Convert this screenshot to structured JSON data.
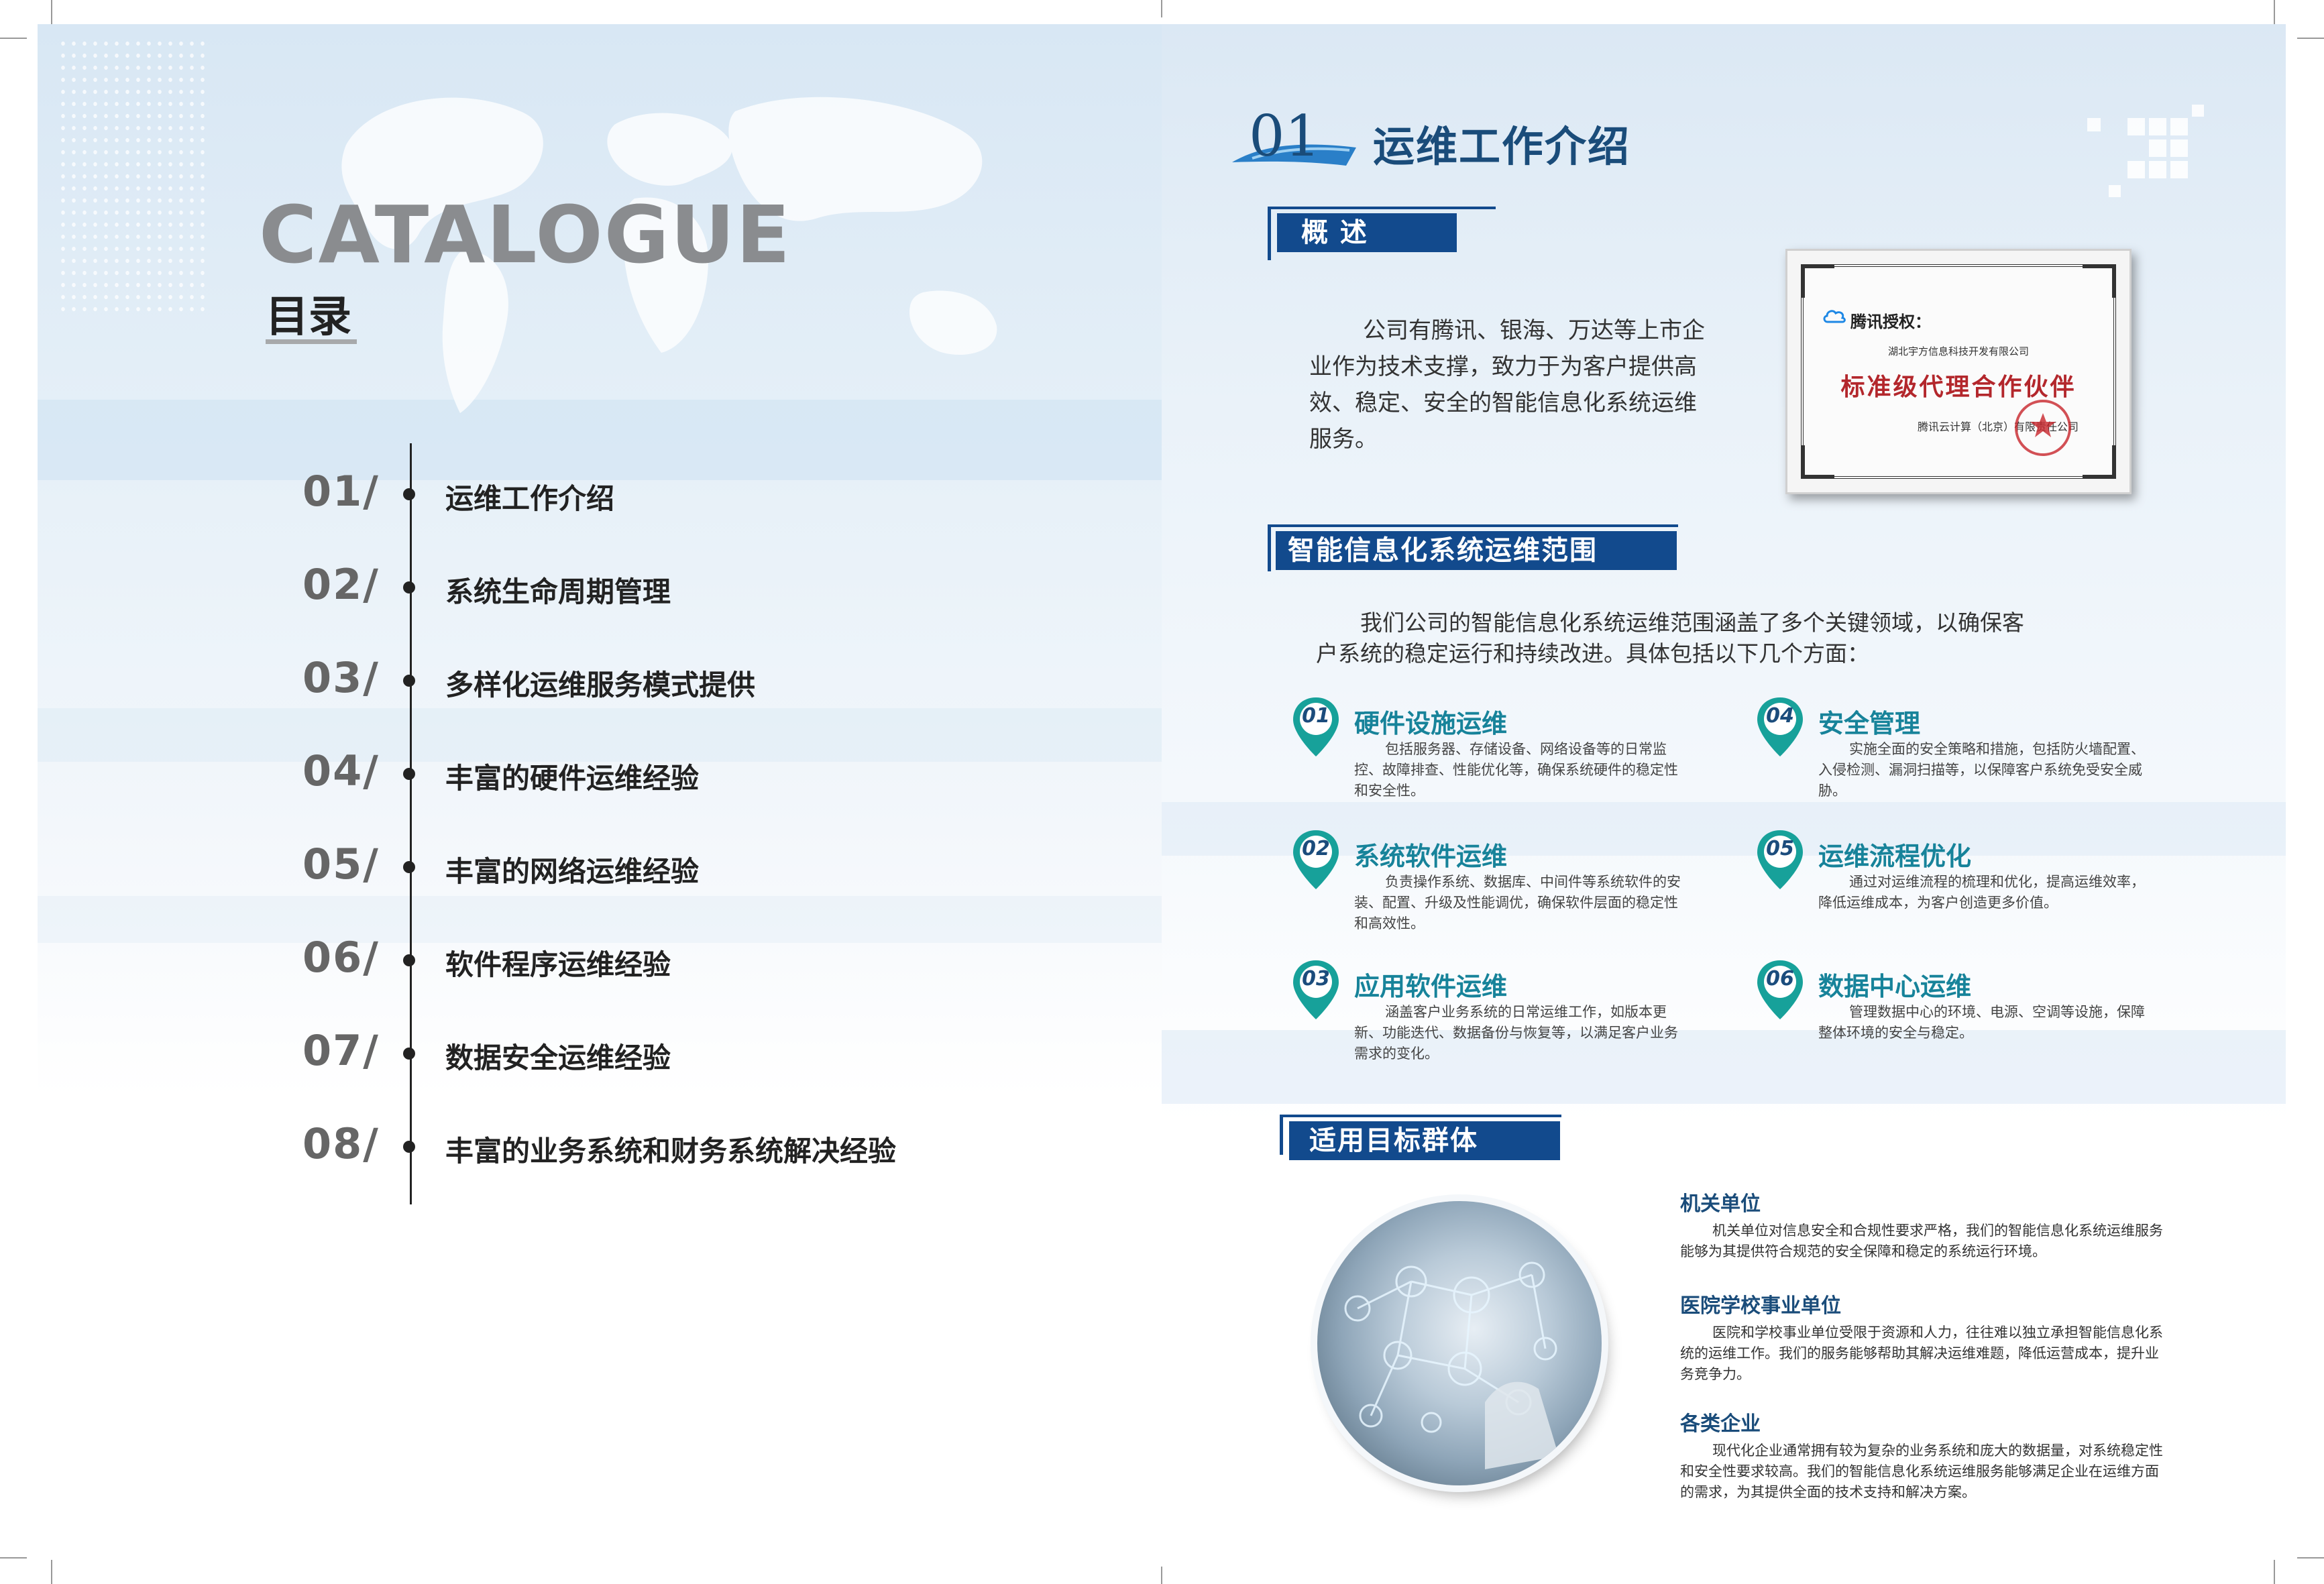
{
  "left_page": {
    "catalogue_title": "CATALOGUE",
    "toc_title": "目录",
    "toc": [
      {
        "num": "01/",
        "label": "运维工作介绍"
      },
      {
        "num": "02/",
        "label": "系统生命周期管理"
      },
      {
        "num": "03/",
        "label": "多样化运维服务模式提供"
      },
      {
        "num": "04/",
        "label": "丰富的硬件运维经验"
      },
      {
        "num": "05/",
        "label": "丰富的网络运维经验"
      },
      {
        "num": "06/",
        "label": "软件程序运维经验"
      },
      {
        "num": "07/",
        "label": "数据安全运维经验"
      },
      {
        "num": "08/",
        "label": "丰富的业务系统和财务系统解决经验"
      }
    ]
  },
  "right_page": {
    "section_number": "01",
    "section_title": "运维工作介绍",
    "overview": {
      "heading": "概 述",
      "text": "公司有腾讯、银海、万达等上市企业作为技术支撑，致力于为客户提供高效、稳定、安全的智能信息化系统运维服务。"
    },
    "certificate": {
      "brand": "腾讯授权：",
      "company": "湖北宇方信息科技开发有限公司",
      "title": "标准级代理合作伙伴",
      "issuer": "腾讯云计算（北京）有限责任公司"
    },
    "scope": {
      "heading": "智能信息化系统运维范围",
      "intro": "我们公司的智能信息化系统运维范围涵盖了多个关键领域，以确保客户系统的稳定运行和持续改进。具体包括以下几个方面：",
      "items": [
        {
          "num": "01",
          "title": "硬件设施运维",
          "desc": "包括服务器、存储设备、网络设备等的日常监控、故障排查、性能优化等，确保系统硬件的稳定性和安全性。"
        },
        {
          "num": "02",
          "title": "系统软件运维",
          "desc": "负责操作系统、数据库、中间件等系统软件的安装、配置、升级及性能调优，确保软件层面的稳定性和高效性。"
        },
        {
          "num": "03",
          "title": "应用软件运维",
          "desc": "涵盖客户业务系统的日常运维工作，如版本更新、功能迭代、数据备份与恢复等，以满足客户业务需求的变化。"
        },
        {
          "num": "04",
          "title": "安全管理",
          "desc": "实施全面的安全策略和措施，包括防火墙配置、入侵检测、漏洞扫描等，以保障客户系统免受安全威胁。"
        },
        {
          "num": "05",
          "title": "运维流程优化",
          "desc": "通过对运维流程的梳理和优化，提高运维效率，降低运维成本，为客户创造更多价值。"
        },
        {
          "num": "06",
          "title": "数据中心运维",
          "desc": "管理数据中心的环境、电源、空调等设施，保障整体环境的安全与稳定。"
        }
      ]
    },
    "targets": {
      "heading": "适用目标群体",
      "items": [
        {
          "title": "机关单位",
          "desc": "机关单位对信息安全和合规性要求严格，我们的智能信息化系统运维服务能够为其提供符合规范的安全保障和稳定的系统运行环境。"
        },
        {
          "title": "医院学校事业单位",
          "desc": "医院和学校事业单位受限于资源和人力，往往难以独立承担智能信息化系统的运维工作。我们的服务能够帮助其解决运维难题，降低运营成本，提升业务竞争力。"
        },
        {
          "title": "各类企业",
          "desc": "现代化企业通常拥有较为复杂的业务系统和庞大的数据量，对系统稳定性和安全性要求较高。我们的智能信息化系统运维服务能够满足企业在运维方面的需求，为其提供全面的技术支持和解决方案。"
        }
      ]
    }
  },
  "colors": {
    "brand_blue": "#124a8d",
    "title_blue": "#1a4c7a",
    "teal": "#17839a",
    "seal_red": "#c8262c"
  }
}
